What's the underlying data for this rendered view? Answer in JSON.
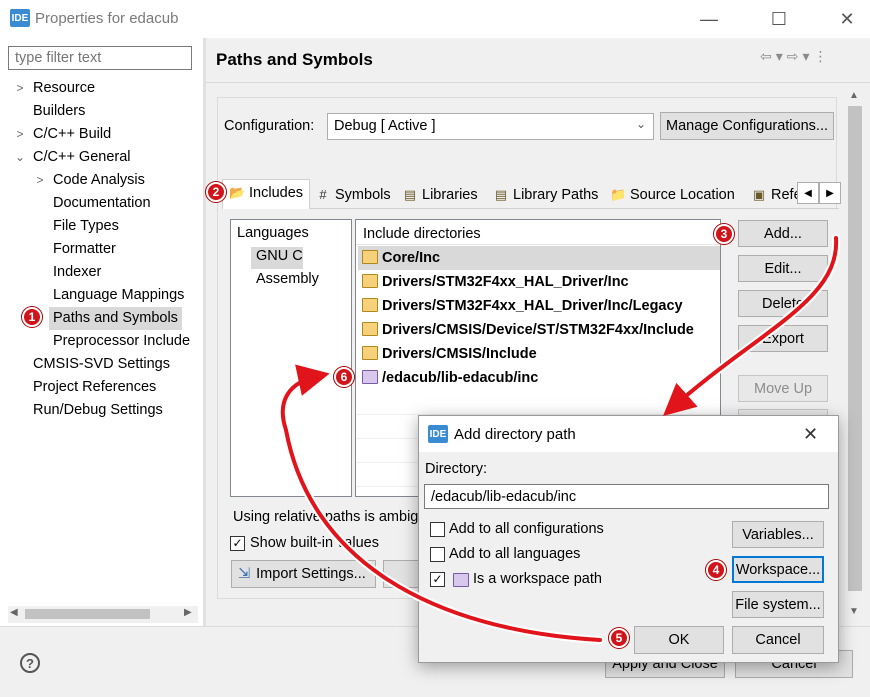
{
  "window": {
    "title": "Properties for edacub",
    "logo": "IDE"
  },
  "filter": {
    "placeholder": "type filter text"
  },
  "tree": {
    "items": [
      {
        "label": "Resource",
        "arrow": "right"
      },
      {
        "label": "Builders",
        "arrow": ""
      },
      {
        "label": "C/C++ Build",
        "arrow": "right"
      },
      {
        "label": "C/C++ General",
        "arrow": "down"
      },
      {
        "label": "Code Analysis",
        "arrow": "right"
      },
      {
        "label": "Documentation",
        "arrow": ""
      },
      {
        "label": "File Types",
        "arrow": ""
      },
      {
        "label": "Formatter",
        "arrow": ""
      },
      {
        "label": "Indexer",
        "arrow": ""
      },
      {
        "label": "Language Mappings",
        "arrow": ""
      },
      {
        "label": "Paths and Symbols",
        "arrow": ""
      },
      {
        "label": "Preprocessor Include",
        "arrow": ""
      },
      {
        "label": "CMSIS-SVD Settings",
        "arrow": ""
      },
      {
        "label": "Project References",
        "arrow": ""
      },
      {
        "label": "Run/Debug Settings",
        "arrow": ""
      }
    ]
  },
  "page": {
    "title": "Paths and Symbols"
  },
  "configuration": {
    "label": "Configuration:",
    "value": "Debug  [ Active ]",
    "manage_label": "Manage Configurations..."
  },
  "tabs": [
    {
      "label": "Includes",
      "icon": "includes-icon",
      "glyph": "📂"
    },
    {
      "label": "Symbols",
      "icon": "hash-icon",
      "glyph": "#"
    },
    {
      "label": "Libraries",
      "icon": "libraries-icon",
      "glyph": "▤"
    },
    {
      "label": "Library Paths",
      "icon": "library-paths-icon",
      "glyph": "▤"
    },
    {
      "label": "Source Location",
      "icon": "source-location-icon",
      "glyph": "📁"
    },
    {
      "label": "Refe",
      "icon": "references-icon",
      "glyph": "▣"
    }
  ],
  "languages": {
    "header": "Languages",
    "items": [
      "GNU C",
      "Assembly"
    ]
  },
  "includes": {
    "header": "Include directories",
    "rows": [
      "Core/Inc",
      "Drivers/STM32F4xx_HAL_Driver/Inc",
      "Drivers/STM32F4xx_HAL_Driver/Inc/Legacy",
      "Drivers/CMSIS/Device/ST/STM32F4xx/Include",
      "Drivers/CMSIS/Include",
      "/edacub/lib-edacub/inc"
    ]
  },
  "side_buttons": {
    "add": "Add...",
    "edit": "Edit...",
    "delete": "Delete",
    "export": "Export",
    "move_up": "Move Up"
  },
  "relative_paths_text": "Using relative paths is ambig",
  "show_builtin_label": "Show built-in values",
  "show_builtin_checked": true,
  "import_settings_label": "Import Settings...",
  "footer": {
    "apply_close": "Apply and Close",
    "cancel": "Cancel"
  },
  "dialog": {
    "title": "Add directory path",
    "directory_label": "Directory:",
    "directory_value": "/edacub/lib-edacub/inc",
    "add_all_configs": "Add to all configurations",
    "add_all_languages": "Add to all languages",
    "workspace_path": "Is a workspace path",
    "add_all_configs_checked": false,
    "add_all_languages_checked": false,
    "workspace_path_checked": true,
    "variables_label": "Variables...",
    "workspace_label": "Workspace...",
    "file_system_label": "File system...",
    "ok_label": "OK",
    "cancel_label": "Cancel"
  },
  "markers": [
    "1",
    "2",
    "3",
    "4",
    "5",
    "6"
  ],
  "colors": {
    "marker_red": "#d0141a",
    "focus_blue": "#0078d7",
    "selection_gray": "#d9d9d9"
  }
}
